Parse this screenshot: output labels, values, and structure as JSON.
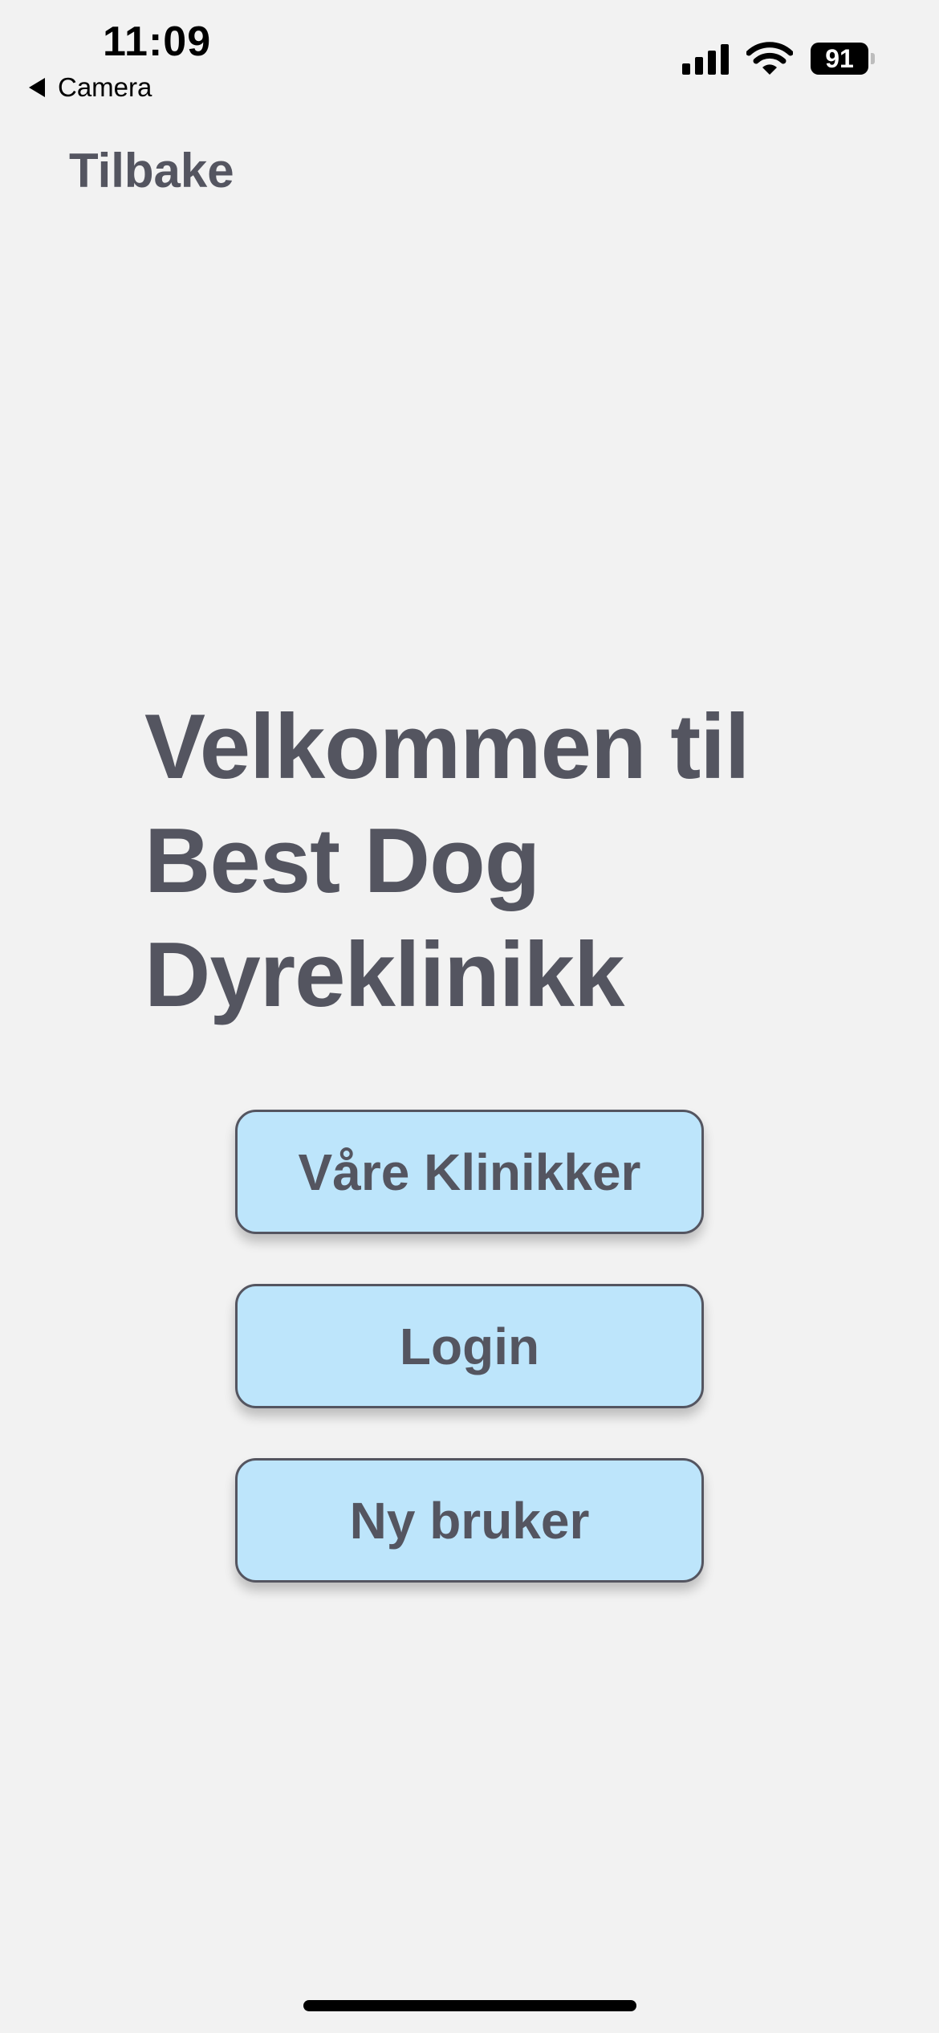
{
  "status_bar": {
    "time": "11:09",
    "back_app": "Camera",
    "battery_level": "91",
    "signal_icon": "cellular-signal-icon",
    "wifi_icon": "wifi-icon"
  },
  "nav": {
    "back_label": "Tilbake"
  },
  "main": {
    "title_lines": [
      "Velkommen til",
      "Best Dog",
      "Dyreklinikk"
    ],
    "buttons": {
      "clinics": "Våre Klinikker",
      "login": "Login",
      "new_user": "Ny bruker"
    }
  },
  "colors": {
    "background": "#f2f2f2",
    "text": "#545560",
    "button_fill": "#bde5fb",
    "button_border": "#545560"
  }
}
